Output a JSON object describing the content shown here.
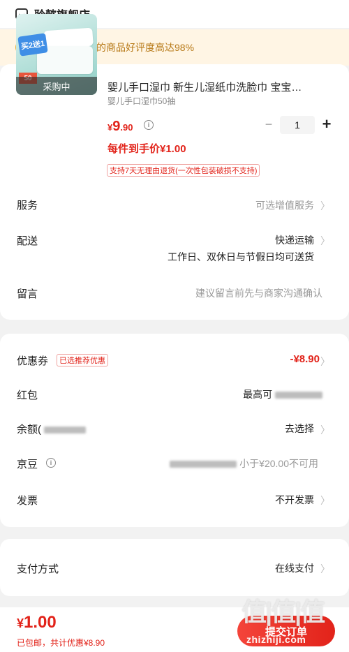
{
  "shop": {
    "name": "聆懿旗舰店",
    "icon": "shop-icon"
  },
  "banner": {
    "icon": "thumbs-up-icon",
    "text": "恭喜你，挑选的商品好评度高达98%"
  },
  "product": {
    "image_promo": "买2送1",
    "image_count": "50",
    "image_status": "采购中",
    "title": "婴儿手口湿巾 新生儿湿纸巾洗脸巾 宝宝…",
    "spec": "婴儿手口湿巾50抽",
    "price_currency": "¥",
    "price_int": "9",
    "price_dec": ".90",
    "quantity": "1",
    "unit_price_text": "每件到手价¥1.00",
    "return_policy": "支持7天无理由退货(一次性包装破损不支持)"
  },
  "rows": {
    "service": {
      "label": "服务",
      "value": "可选增值服务"
    },
    "delivery": {
      "label": "配送",
      "value": "快递运输",
      "sub": "工作日、双休日与节假日均可送货"
    },
    "note": {
      "label": "留言",
      "placeholder": "建议留言前先与商家沟通确认"
    },
    "coupon": {
      "label": "优惠券",
      "tag": "已选推荐优惠",
      "value": "-¥8.90"
    },
    "redpacket": {
      "label": "红包",
      "value": "最高可"
    },
    "balance": {
      "label": "余额(",
      "value": "去选择"
    },
    "jingdou": {
      "label": "京豆",
      "value": "小于¥20.00不可用"
    },
    "invoice": {
      "label": "发票",
      "value": "不开发票"
    },
    "payment": {
      "label": "支付方式",
      "value": "在线支付"
    }
  },
  "footer": {
    "total_currency": "¥",
    "total_value": "1.00",
    "sub": "已包邮，共计优惠¥8.90",
    "submit": "提交订单",
    "watermark": "值|值|值",
    "watermark_url": "zhizhiji.com"
  },
  "colors": {
    "accent": "#e2231a",
    "banner_bg": "#fff5e4",
    "banner_text": "#b77917"
  }
}
